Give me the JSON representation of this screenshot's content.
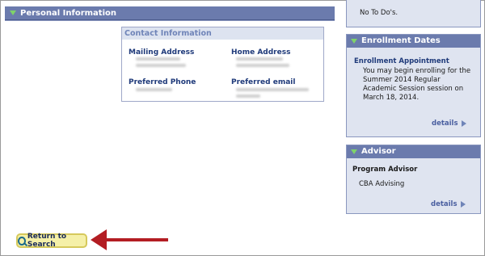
{
  "personal_info": {
    "title": "Personal Information",
    "contact": {
      "title": "Contact Information",
      "mailing_address_label": "Mailing Address",
      "home_address_label": "Home Address",
      "preferred_phone_label": "Preferred Phone",
      "preferred_email_label": "Preferred email"
    }
  },
  "todos": {
    "text": "No To Do's."
  },
  "enrollment_dates": {
    "title": "Enrollment Dates",
    "subtitle": "Enrollment Appointment",
    "body": "You may begin enrolling for the Summer 2014 Regular Academic Session session on March 18, 2014.",
    "details_label": "details"
  },
  "advisor": {
    "title": "Advisor",
    "subtitle": "Program Advisor",
    "name": "CBA Advising",
    "details_label": "details"
  },
  "return_button": {
    "label": "Return to Search",
    "icon": "search-icon"
  },
  "colors": {
    "header_bg": "#6b7bad",
    "panel_bg": "#dfe4f0",
    "label_blue": "#1f3a7a",
    "arrow_red": "#b31d23",
    "button_yellow": "#f5f0a8"
  }
}
